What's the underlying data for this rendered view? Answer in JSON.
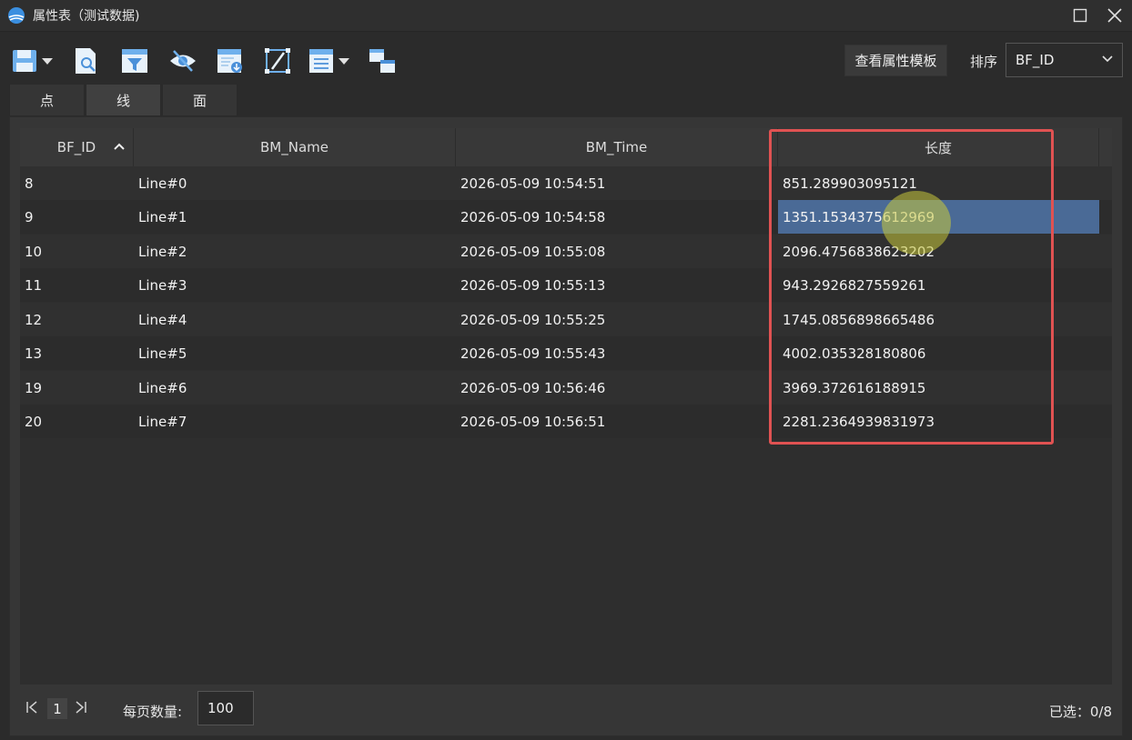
{
  "window": {
    "title": "属性表（测试数据)"
  },
  "toolbar": {
    "template_label": "查看属性模板",
    "sort_label": "排序",
    "sort_value": "BF_ID"
  },
  "tabs": [
    {
      "label": "点"
    },
    {
      "label": "线"
    },
    {
      "label": "面"
    }
  ],
  "table": {
    "columns": [
      "BF_ID",
      "BM_Name",
      "BM_Time",
      "长度"
    ],
    "rows": [
      [
        "8",
        "Line#0",
        "2026-05-09 10:54:51",
        "851.289903095121"
      ],
      [
        "9",
        "Line#1",
        "2026-05-09 10:54:58",
        "1351.1534375612969"
      ],
      [
        "10",
        "Line#2",
        "2026-05-09 10:55:08",
        "2096.4756838623202"
      ],
      [
        "11",
        "Line#3",
        "2026-05-09 10:55:13",
        "943.2926827559261"
      ],
      [
        "12",
        "Line#4",
        "2026-05-09 10:55:25",
        "1745.0856898665486"
      ],
      [
        "13",
        "Line#5",
        "2026-05-09 10:55:43",
        "4002.035328180806"
      ],
      [
        "19",
        "Line#6",
        "2026-05-09 10:56:46",
        "3969.372616188915"
      ],
      [
        "20",
        "Line#7",
        "2026-05-09 10:56:51",
        "2281.2364939831973"
      ]
    ]
  },
  "pager": {
    "page": "1",
    "page_size_label": "每页数量:",
    "page_size_value": "100",
    "selected_label": "已选：0/8"
  },
  "colors": {
    "accent": "#4a6a96",
    "highlight": "#e05252"
  }
}
